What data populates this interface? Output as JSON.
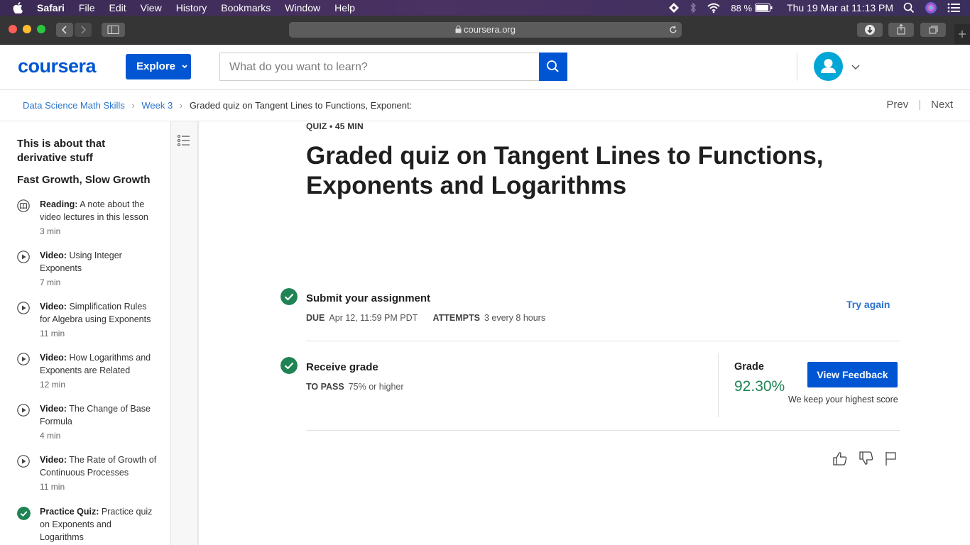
{
  "menubar": {
    "app": "Safari",
    "items": [
      "File",
      "Edit",
      "View",
      "History",
      "Bookmarks",
      "Window",
      "Help"
    ],
    "battery": "88 %",
    "clock": "Thu 19 Mar at  11:13 PM"
  },
  "browser": {
    "url": "coursera.org"
  },
  "header": {
    "logo": "coursera",
    "explore": "Explore",
    "search_placeholder": "What do you want to learn?"
  },
  "breadcrumb": {
    "items": [
      "Data Science Math Skills",
      "Week 3"
    ],
    "current": "Graded quiz on Tangent Lines to Functions, Exponent:",
    "prev": "Prev",
    "next": "Next"
  },
  "sidebar": {
    "lesson_title": "This is about that derivative stuff",
    "group_title": "Fast Growth, Slow Growth",
    "items": [
      {
        "type": "Reading:",
        "title": "A note about the video lectures in this lesson",
        "duration": "3 min"
      },
      {
        "type": "Video:",
        "title": "Using Integer Exponents",
        "duration": "7 min"
      },
      {
        "type": "Video:",
        "title": "Simplification Rules for Algebra using Exponents",
        "duration": "11 min"
      },
      {
        "type": "Video:",
        "title": "How Logarithms and Exponents are Related",
        "duration": "12 min"
      },
      {
        "type": "Video:",
        "title": "The Change of Base Formula",
        "duration": "4 min"
      },
      {
        "type": "Video:",
        "title": "The Rate of Growth of Continuous Processes",
        "duration": "11 min"
      },
      {
        "type": "Practice Quiz:",
        "title": "Practice quiz on Exponents and Logarithms",
        "duration": ""
      }
    ]
  },
  "quiz": {
    "kicker": "QUIZ • 45 MIN",
    "title": "Graded quiz on Tangent Lines to Functions, Exponents and Logarithms",
    "submit": {
      "title": "Submit your assignment",
      "due_label": "DUE",
      "due": "Apr 12, 11:59 PM PDT",
      "attempts_label": "ATTEMPTS",
      "attempts": "3 every 8 hours",
      "try_again": "Try again"
    },
    "receive": {
      "title": "Receive grade",
      "pass_label": "TO PASS",
      "pass": "75% or higher",
      "grade_label": "Grade",
      "grade": "92.30%",
      "view_feedback": "View Feedback",
      "note": "We keep your highest score"
    }
  },
  "colors": {
    "brand": "#0056d2",
    "success": "#1f8354",
    "link": "#2a73cc"
  }
}
